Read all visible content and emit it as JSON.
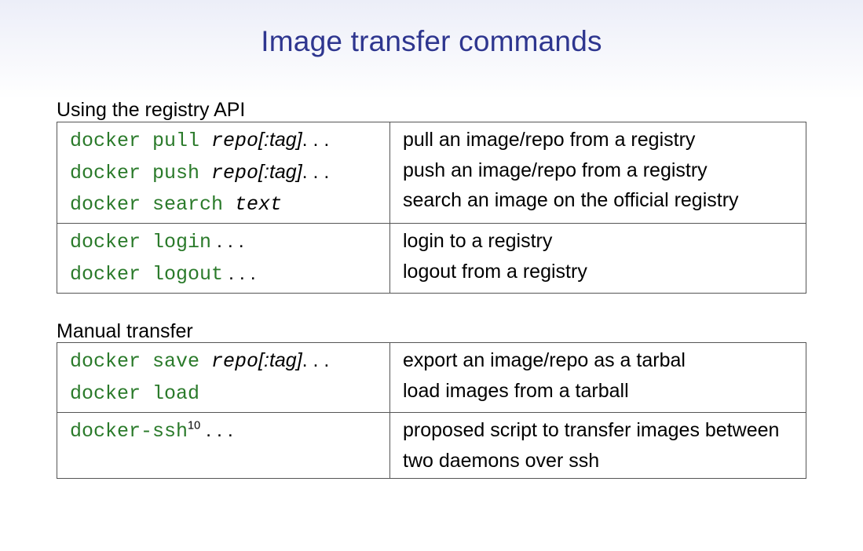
{
  "title": "Image transfer commands",
  "section1": {
    "heading": "Using the registry API",
    "rows_group1": [
      {
        "cmd_pre": "docker pull",
        "cmd_arg": " repo",
        "cmd_post": "[:tag]",
        "cmd_tail": ". . .",
        "desc": "pull an image/repo from a registry"
      },
      {
        "cmd_pre": "docker push",
        "cmd_arg": " repo",
        "cmd_post": "[:tag]",
        "cmd_tail": ". . .",
        "desc": "push an image/repo from a registry"
      },
      {
        "cmd_pre": "docker search",
        "cmd_arg": " text",
        "cmd_post": "",
        "cmd_tail": "",
        "desc": "search an image on the official registry"
      }
    ],
    "rows_group2": [
      {
        "cmd_pre": "docker login",
        "cmd_arg": "",
        "cmd_post": "",
        "cmd_tail": " . . .",
        "desc": "login to a registry"
      },
      {
        "cmd_pre": "docker logout",
        "cmd_arg": "",
        "cmd_post": "",
        "cmd_tail": " . . .",
        "desc": "logout from a registry"
      }
    ]
  },
  "section2": {
    "heading": "Manual transfer",
    "rows_group1": [
      {
        "cmd_pre": "docker save",
        "cmd_arg": " repo",
        "cmd_post": "[:tag]",
        "cmd_tail": ". . .",
        "desc": "export an image/repo as a tarbal"
      },
      {
        "cmd_pre": "docker load",
        "cmd_arg": "",
        "cmd_post": "",
        "cmd_tail": "",
        "desc": "load images from a tarball"
      }
    ],
    "rows_group2": [
      {
        "cmd_pre": "docker-ssh",
        "cmd_sup": "10",
        "cmd_tail": " . . .",
        "desc": "proposed script to transfer images between two daemons over ssh"
      }
    ]
  }
}
